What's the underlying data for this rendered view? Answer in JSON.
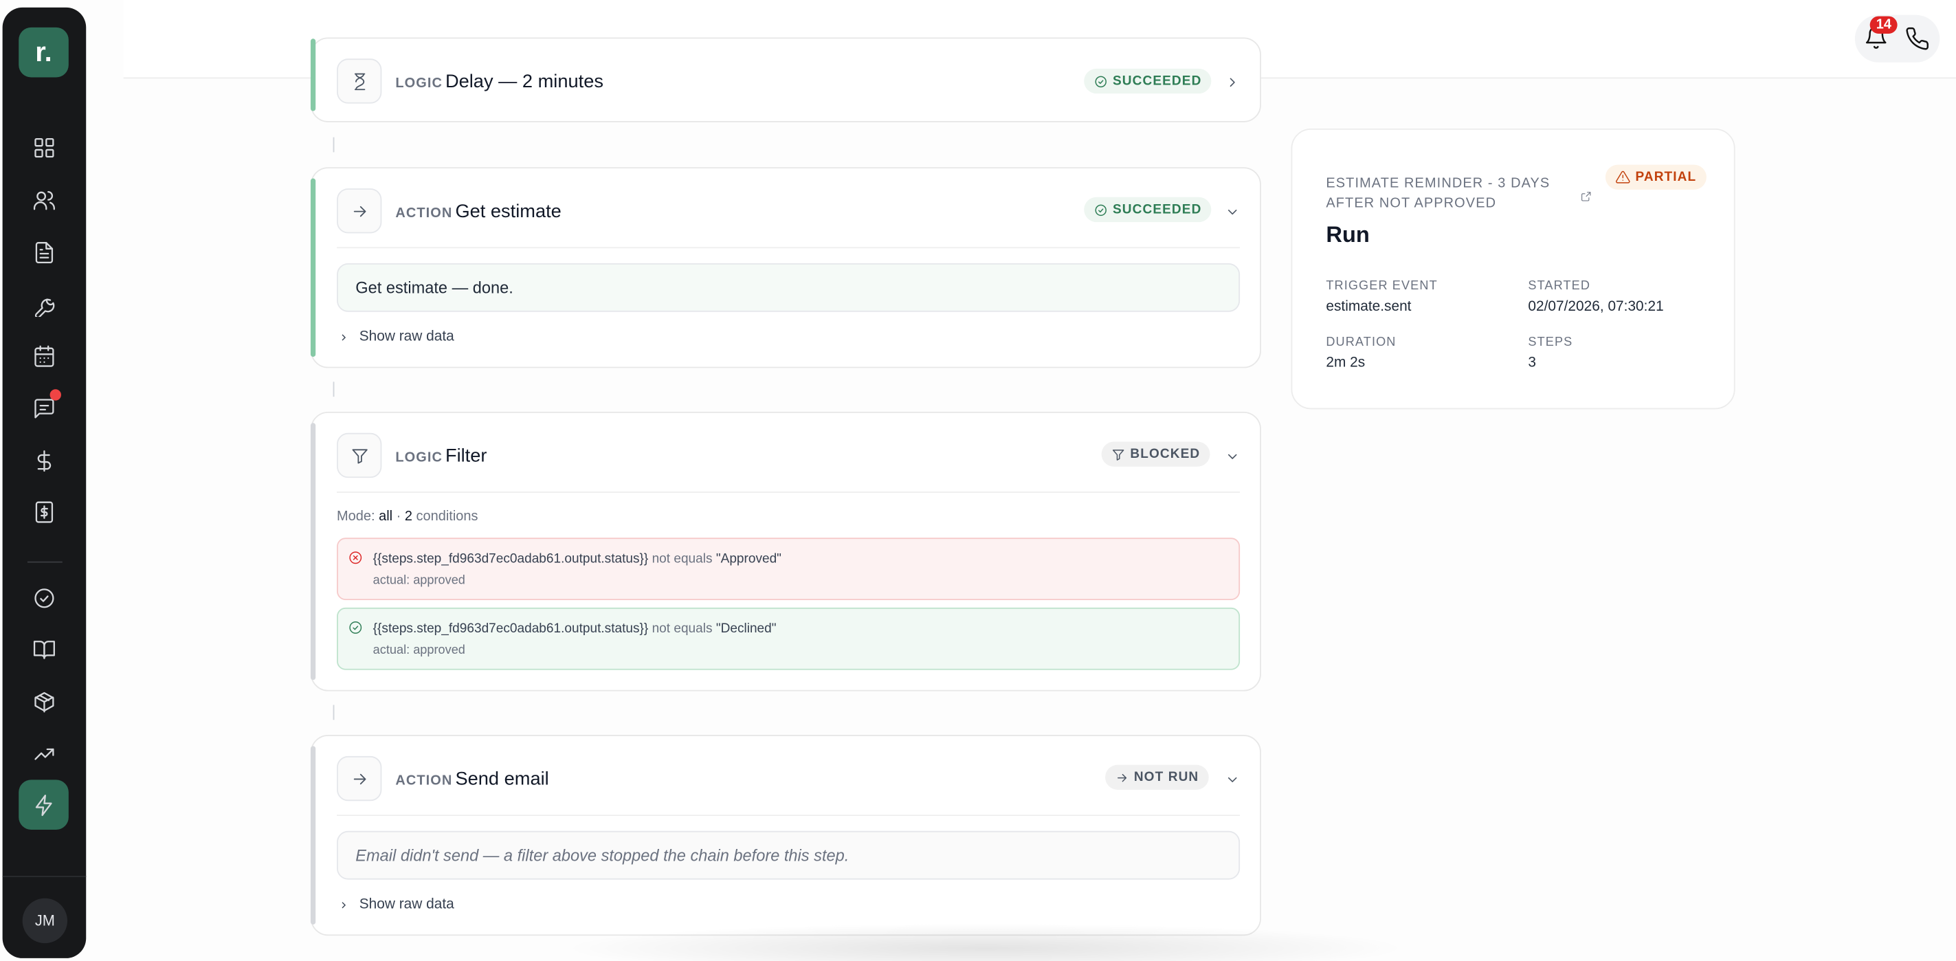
{
  "app": {
    "logo_text": "r.",
    "user_initials": "JM",
    "notification_count": "14"
  },
  "sidebar": {
    "items": [
      {
        "name": "dashboard-icon"
      },
      {
        "name": "users-icon"
      },
      {
        "name": "document-icon"
      },
      {
        "name": "wrench-icon"
      },
      {
        "name": "calendar-icon"
      },
      {
        "name": "chat-icon"
      },
      {
        "name": "dollar-icon"
      },
      {
        "name": "invoice-icon"
      },
      {
        "name": "check-circle-icon"
      },
      {
        "name": "book-icon"
      },
      {
        "name": "box-icon"
      },
      {
        "name": "trending-icon"
      },
      {
        "name": "lightning-icon",
        "active": true
      }
    ]
  },
  "steps": [
    {
      "kind": "LOGIC",
      "title": "Delay — 2 minutes",
      "status": "SUCCEEDED",
      "status_tone": "green"
    },
    {
      "kind": "ACTION",
      "title": "Get estimate",
      "status": "SUCCEEDED",
      "status_tone": "green",
      "note": "Get estimate — done.",
      "raw_label": "Show raw data"
    },
    {
      "kind": "LOGIC",
      "title": "Filter",
      "status": "BLOCKED",
      "status_tone": "gray",
      "mode_prefix": "Mode:",
      "mode_value": "all",
      "mode_sep": "·",
      "conditions_count": "2",
      "conditions_label": "conditions",
      "conditions": [
        {
          "expr": "{{steps.step_fd963d7ec0adab61.output.status}}",
          "op": "not equals",
          "value": "\"Approved\"",
          "actual": "actual: approved",
          "passed": false
        },
        {
          "expr": "{{steps.step_fd963d7ec0adab61.output.status}}",
          "op": "not equals",
          "value": "\"Declined\"",
          "actual": "actual: approved",
          "passed": true
        }
      ]
    },
    {
      "kind": "ACTION",
      "title": "Send email",
      "status": "NOT RUN",
      "status_tone": "gray",
      "note": "Email didn't send — a filter above stopped the chain before this step.",
      "raw_label": "Show raw data"
    }
  ],
  "run_panel": {
    "workflow_name": "ESTIMATE REMINDER - 3 DAYS AFTER NOT APPROVED",
    "status": "PARTIAL",
    "heading": "Run",
    "trigger_event_label": "TRIGGER EVENT",
    "trigger_event": "estimate.sent",
    "started_label": "STARTED",
    "started": "02/07/2026, 07:30:21",
    "duration_label": "DURATION",
    "duration": "2m 2s",
    "steps_label": "STEPS",
    "steps": "3"
  },
  "colors": {
    "brand": "#2f6d57",
    "success": "#2e7d55",
    "danger": "#dc2626",
    "warning": "#c2410c",
    "sidebar_bg": "#17181a"
  }
}
